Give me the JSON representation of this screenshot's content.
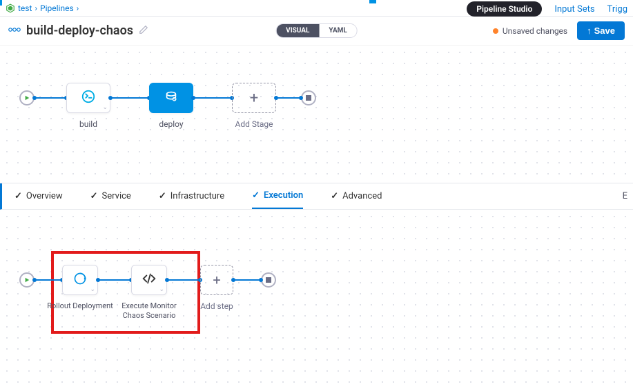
{
  "breadcrumb": {
    "item1": "test",
    "item2": "Pipelines"
  },
  "topnav": {
    "studio": "Pipeline Studio",
    "input_sets": "Input Sets",
    "triggers": "Trigg"
  },
  "title": {
    "pipeline_name": "build-deploy-chaos"
  },
  "view_toggle": {
    "visual": "VISUAL",
    "yaml": "YAML"
  },
  "actions": {
    "unsaved": "Unsaved changes",
    "save": "Save"
  },
  "stages": {
    "build": {
      "label": "build"
    },
    "deploy": {
      "label": "deploy"
    },
    "add": {
      "label": "Add Stage"
    }
  },
  "tabs": {
    "overview": "Overview",
    "service": "Service",
    "infrastructure": "Infrastructure",
    "execution": "Execution",
    "advanced": "Advanced",
    "expand": "E"
  },
  "steps": {
    "rollout": {
      "label": "Rollout Deployment"
    },
    "chaos": {
      "label": "Execute Monitor Chaos Scenario"
    },
    "add": {
      "label": "Add step"
    }
  },
  "colors": {
    "accent": "#0378d5",
    "primary": "#0092e4",
    "warn": "#ff832b"
  }
}
